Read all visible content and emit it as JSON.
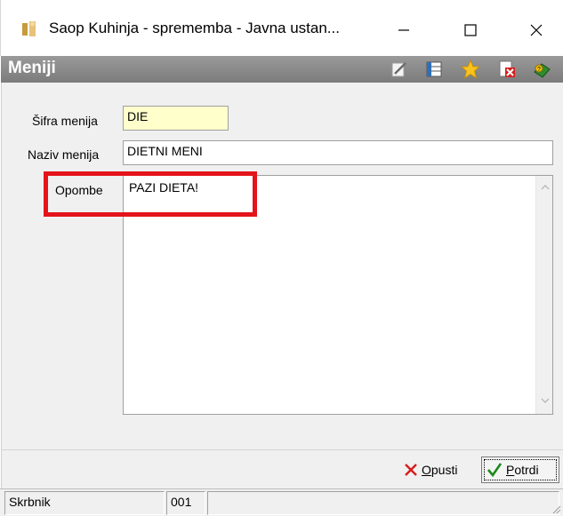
{
  "window": {
    "title": "Saop Kuhinja - sprememba - Javna ustan...",
    "controls": {
      "minimize": "—",
      "maximize": "☐",
      "close": "✕"
    }
  },
  "header": {
    "title": "Meniji",
    "toolbar_icons": [
      "edit-note-icon",
      "table-columns-icon",
      "star-icon",
      "delete-document-icon",
      "help-book-icon"
    ]
  },
  "form": {
    "sifra": {
      "label": "Šifra menija",
      "value": "DIE"
    },
    "naziv": {
      "label": "Naziv menija",
      "value": "DIETNI MENI"
    },
    "opombe": {
      "label": "Opombe",
      "value": "PAZI DIETA!"
    }
  },
  "buttons": {
    "cancel": {
      "label": "Opusti",
      "mnemonic": "O",
      "rest": "pusti"
    },
    "confirm": {
      "label": "Potrdi",
      "mnemonic": "P",
      "rest": "otrdi"
    }
  },
  "statusbar": {
    "user": "Skrbnik",
    "code": "001",
    "extra": ""
  },
  "colors": {
    "header_bg": "#888888",
    "highlight": "#e3141a",
    "code_field_bg": "#ffffcc",
    "cancel_icon": "#d81b1b",
    "confirm_icon": "#1a8a1a"
  }
}
